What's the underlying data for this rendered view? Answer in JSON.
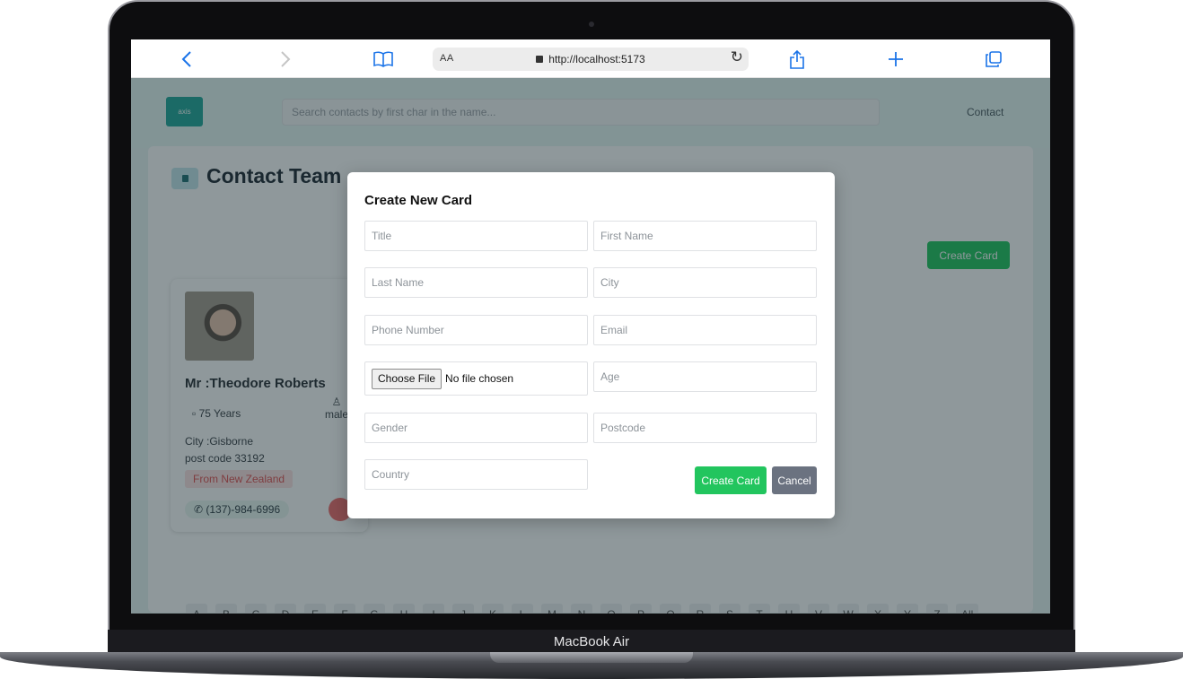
{
  "device": {
    "label": "MacBook Air"
  },
  "browser": {
    "reader_label": "AA",
    "url": "http://localhost:5173",
    "icons": [
      "back-icon",
      "forward-icon",
      "bookmarks-icon",
      "lock-icon",
      "reload-icon",
      "share-icon",
      "new-tab-icon",
      "tabs-icon"
    ]
  },
  "app": {
    "logo_text": "axis",
    "search_placeholder": "Search contacts by first char in the name...",
    "nav_contact": "Contact",
    "page_title": "Contact Team",
    "create_card_label": "Create Card"
  },
  "contact_card": {
    "name": "Mr :Theodore Roberts",
    "age": "75 Years",
    "gender": "male",
    "city": "City :Gisborne",
    "postcode": "post code 33192",
    "country": "From New Zealand",
    "phone": "(137)-984-6996"
  },
  "alphabet": [
    "A",
    "B",
    "C",
    "D",
    "E",
    "F",
    "G",
    "H",
    "I",
    "J",
    "K",
    "L",
    "M",
    "N",
    "O",
    "P",
    "Q",
    "R",
    "S",
    "T",
    "U",
    "V",
    "W",
    "X",
    "Y",
    "Z",
    "All"
  ],
  "modal": {
    "title": "Create New Card",
    "fields": {
      "title": "Title",
      "first_name": "First Name",
      "last_name": "Last Name",
      "city": "City",
      "phone": "Phone Number",
      "email": "Email",
      "age": "Age",
      "gender": "Gender",
      "postcode": "Postcode",
      "country": "Country"
    },
    "file_button": "Choose File",
    "file_status": "No file chosen",
    "create_label": "Create Card",
    "cancel_label": "Cancel"
  },
  "colors": {
    "accent_green": "#22c55e",
    "cancel_gray": "#6b7280",
    "country_badge": "#fde2e2"
  }
}
